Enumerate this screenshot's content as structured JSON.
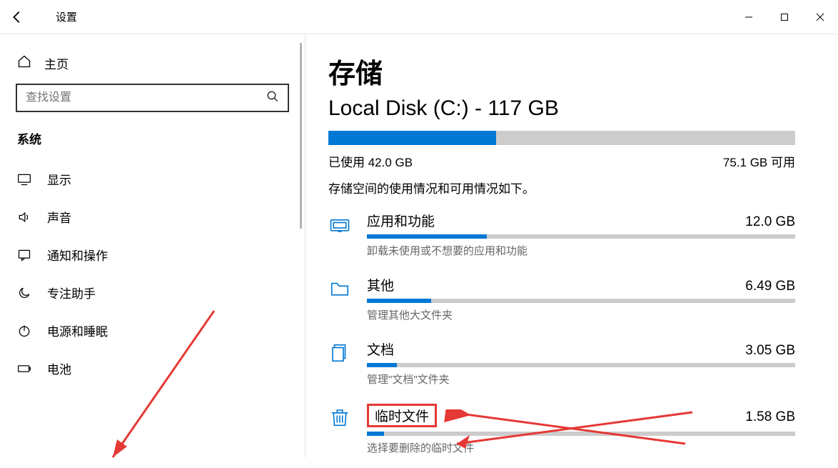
{
  "window": {
    "title": "设置"
  },
  "sidebar": {
    "home": "主页",
    "search_placeholder": "查找设置",
    "section": "系统",
    "items": [
      {
        "label": "显示"
      },
      {
        "label": "声音"
      },
      {
        "label": "通知和操作"
      },
      {
        "label": "专注助手"
      },
      {
        "label": "电源和睡眠"
      },
      {
        "label": "电池"
      }
    ]
  },
  "main": {
    "title": "存储",
    "disk_label": "Local Disk (C:) - 117 GB",
    "used_label": "已使用 42.0 GB",
    "free_label": "75.1 GB 可用",
    "used_pct": 36,
    "desc": "存储空间的使用情况和可用情况如下。",
    "categories": [
      {
        "title": "应用和功能",
        "size": "12.0 GB",
        "pct": 28,
        "sub": "卸载未使用或不想要的应用和功能"
      },
      {
        "title": "其他",
        "size": "6.49 GB",
        "pct": 15,
        "sub": "管理其他大文件夹"
      },
      {
        "title": "文档",
        "size": "3.05 GB",
        "pct": 7,
        "sub": "管理\"文档\"文件夹"
      },
      {
        "title": "临时文件",
        "size": "1.58 GB",
        "pct": 4,
        "sub": "选择要删除的临时文件"
      }
    ]
  }
}
